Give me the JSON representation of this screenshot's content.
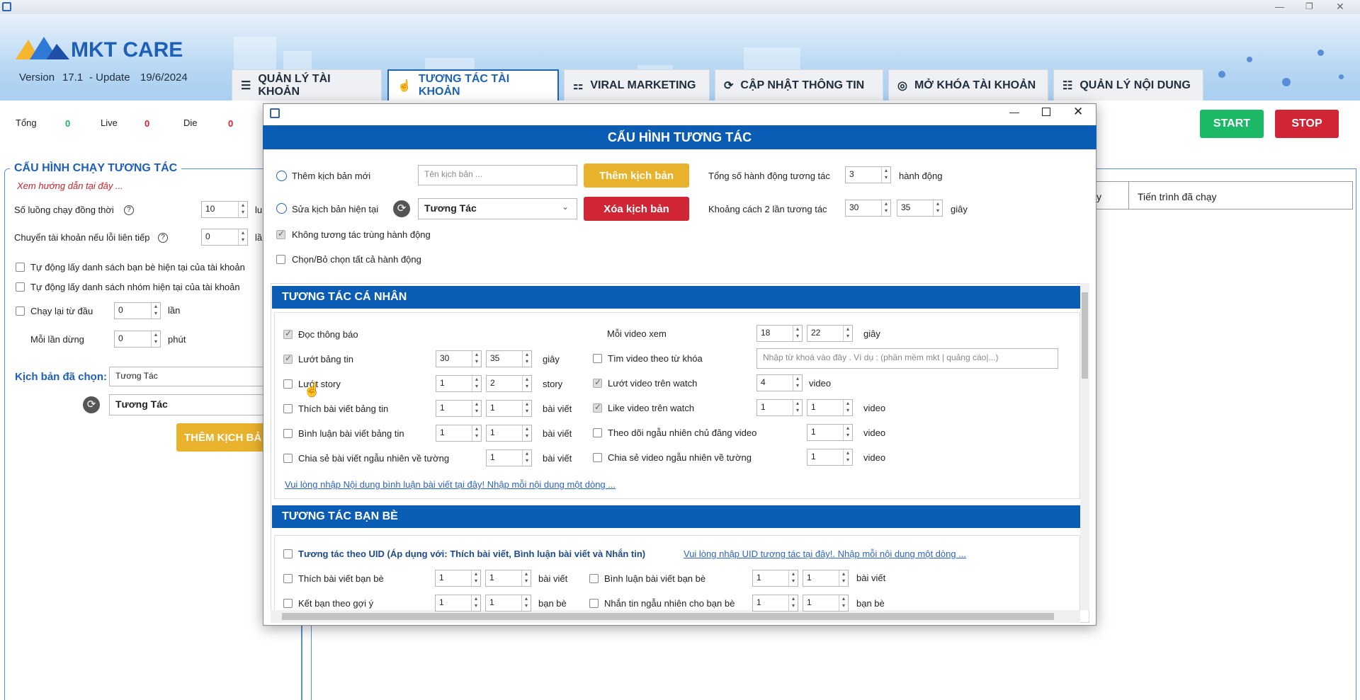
{
  "app": {
    "brand": "MKT CARE",
    "version_label": "Version",
    "version": "17.1",
    "update_label": "- Update",
    "update_date": "19/6/2024"
  },
  "tabs": [
    {
      "label": "QUẢN LÝ TÀI KHOẢN",
      "icon": "list-search-icon"
    },
    {
      "label": "TƯƠNG TÁC TÀI KHOẢN",
      "icon": "hand-pointer-icon"
    },
    {
      "label": "VIRAL MARKETING",
      "icon": "grid-icon"
    },
    {
      "label": "CẬP NHẬT THÔNG TIN",
      "icon": "refresh-check-icon"
    },
    {
      "label": "MỞ KHÓA TÀI KHOẢN",
      "icon": "fingerprint-icon"
    },
    {
      "label": "QUẢN LÝ NỘI DUNG",
      "icon": "document-icon"
    }
  ],
  "stats": {
    "total_label": "Tổng",
    "total": "0",
    "live_label": "Live",
    "live": "0",
    "die_label": "Die",
    "die": "0"
  },
  "actions": {
    "start": "START",
    "stop": "STOP"
  },
  "left_panel": {
    "title": "CẤU HÌNH CHẠY TƯƠNG TÁC",
    "guide": "Xem hướng dẫn tại đây ...",
    "concurrent_label": "Số luồng chạy đồng thời",
    "concurrent": "10",
    "concurrent_unit": "lu",
    "switch_label": "Chuyển tài khoản nếu lỗi liên tiếp",
    "switch": "0",
    "switch_unit": "lầ",
    "auto_friends": "Tự động lấy danh sách bạn bè hiện tại của tài khoản",
    "auto_groups": "Tự động lấy danh sách nhóm hiện tại của tài khoản",
    "rerun_label": "Chạy lại từ đầu",
    "rerun": "0",
    "rerun_unit": "lần",
    "pause_label": "Mỗi lần dừng",
    "pause": "0",
    "pause_unit": "phút",
    "script_label": "Kịch bản đã chọn:",
    "script_value": "Tương Tác",
    "script_select": "Tương Tác",
    "add_script_btn": "THÊM KỊCH BẢ"
  },
  "table": {
    "col_prev": "y",
    "col_progress": "Tiến trình đã chạy"
  },
  "dialog": {
    "title": "CẤU HÌNH TƯƠNG TÁC",
    "new_script_radio": "Thêm kịch bản mới",
    "script_name_placeholder": "Tên kịch bản ...",
    "add_script_btn": "Thêm kịch bản",
    "total_actions_label": "Tổng số hành động tương tác",
    "total_actions": "3",
    "total_actions_unit": "hành động",
    "edit_script_radio": "Sửa kịch bản hiện tại",
    "edit_script_select": "Tương Tác",
    "delete_script_btn": "Xóa kịch bản",
    "interval_label": "Khoảng cách 2 lần tương tác",
    "interval_min": "30",
    "interval_max": "35",
    "interval_unit": "giây",
    "no_duplicate": "Không tương tác trùng hành động",
    "select_all": "Chọn/Bỏ chọn tất cả hành động",
    "personal_title": "TƯƠNG TÁC CÁ NHÂN",
    "p": {
      "read_notif": "Đọc thông báo",
      "scroll_feed": "Lướt bảng tin",
      "scroll_feed_min": "30",
      "scroll_feed_max": "35",
      "scroll_feed_unit": "giây",
      "scroll_story": "Lướt story",
      "story_min": "1",
      "story_max": "2",
      "story_unit": "story",
      "like_post": "Thích bài viết bảng tin",
      "like_post_min": "1",
      "like_post_max": "1",
      "like_post_unit": "bài viết",
      "comment_post": "Bình luận bài viết bảng tin",
      "comment_min": "1",
      "comment_max": "1",
      "comment_unit": "bài viết",
      "share_post": "Chia sẻ bài viết ngẫu nhiên về tường",
      "share_post_n": "1",
      "share_post_unit": "bài viết",
      "video_watch_label": "Mỗi video xem",
      "video_watch_min": "18",
      "video_watch_max": "22",
      "video_watch_unit": "giây",
      "search_video": "Tìm video theo từ khóa",
      "search_placeholder": "Nhập từ khoá vào đây .  Ví dụ : (phần mềm mkt | quảng cáo|...)",
      "scroll_watch": "Lướt video trên watch",
      "scroll_watch_n": "4",
      "scroll_watch_unit": "video",
      "like_watch": "Like video trên watch",
      "like_watch_min": "1",
      "like_watch_max": "1",
      "like_watch_unit": "video",
      "follow_poster": "Theo dõi ngẫu nhiên chủ đăng video",
      "follow_n": "1",
      "follow_unit": "video",
      "share_video": "Chia sẻ video ngẫu nhiên về tường",
      "share_video_n": "1",
      "share_video_unit": "video",
      "comment_link": "Vui lòng nhập Nội dung bình luận bài viết tại đây! Nhập mỗi nội dung một dòng ..."
    },
    "friends_title": "TƯƠNG TÁC BẠN BÈ",
    "f": {
      "uid_label": "Tương tác theo UID (Áp dụng với: Thích bài viết, Bình luận bài viết và Nhắn tin)",
      "uid_link": "Vui lòng nhập UID tương tác tại đây!. Nhập mỗi nội dung một dòng ...",
      "like_friend": "Thích bài viết bạn bè",
      "like_friend_min": "1",
      "like_friend_max": "1",
      "like_friend_unit": "bài viết",
      "comment_friend": "Bình luận bài viết bạn bè",
      "comment_friend_min": "1",
      "comment_friend_max": "1",
      "comment_friend_unit": "bài viết",
      "suggest_friend": "Kết bạn theo gợi ý",
      "suggest_min": "1",
      "suggest_max": "1",
      "suggest_unit": "bạn bè",
      "msg_friend": "Nhắn tin ngẫu nhiên cho bạn bè",
      "msg_min": "1",
      "msg_max": "1",
      "msg_unit": "bạn bè"
    }
  }
}
